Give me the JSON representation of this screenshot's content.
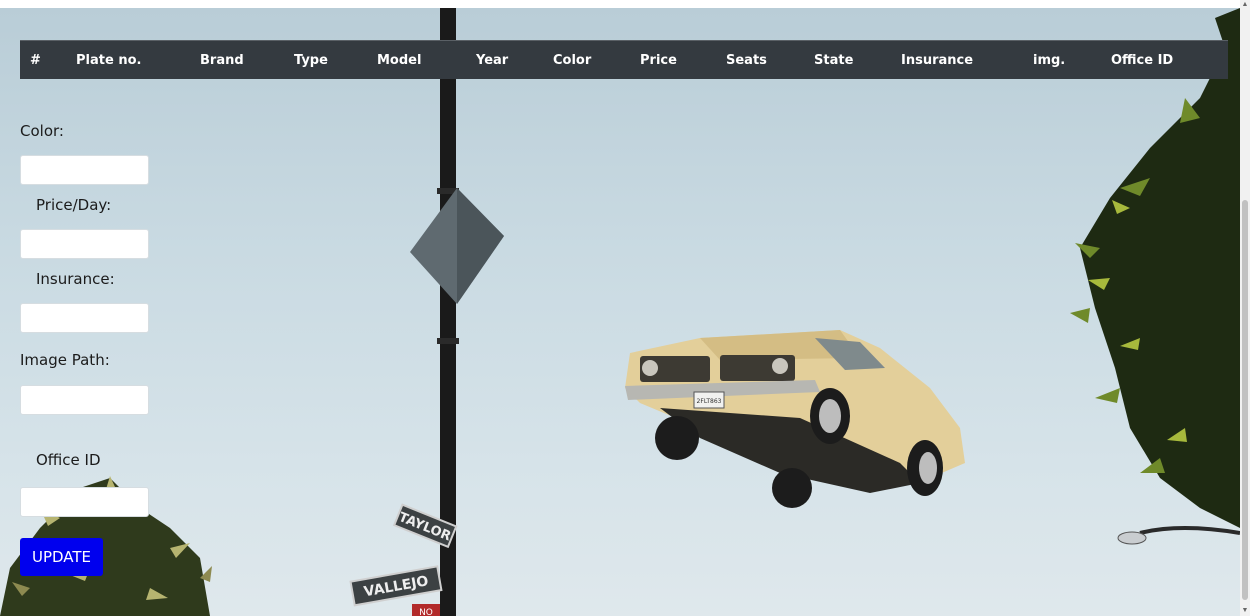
{
  "table": {
    "headers": [
      "#",
      "Plate no.",
      "Brand",
      "Type",
      "Model",
      "Year",
      "Color",
      "Price",
      "Seats",
      "State",
      "Insurance",
      "img.",
      "Office ID"
    ]
  },
  "form": {
    "color_label": "Color:",
    "price_label": "Price/Day:",
    "insurance_label": "Insurance:",
    "image_path_label": "Image Path:",
    "office_id_label": "Office ID",
    "color_value": "",
    "price_value": "",
    "insurance_value": "",
    "image_path_value": "",
    "office_id_value": "",
    "update_label": "UPDATE"
  },
  "scene": {
    "street_signs": [
      "TAYLOR",
      "VALLEJO",
      "NO"
    ],
    "license_plate": "2FLT863",
    "car_color": "#e3cf9a",
    "sky_color": "#c9dae2"
  }
}
